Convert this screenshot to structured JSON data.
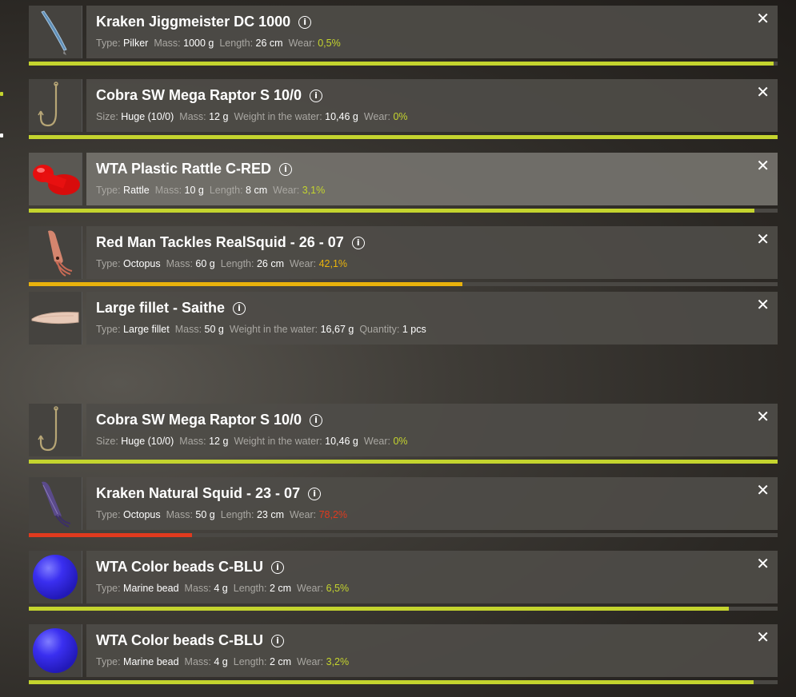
{
  "items": [
    {
      "title": "Kraken Jiggmeister DC 1000",
      "stats": [
        [
          "Type:",
          "Pilker"
        ],
        [
          "Mass:",
          "1000 g"
        ],
        [
          "Length:",
          "26 cm"
        ]
      ],
      "wear_label": "Wear:",
      "wear_value": "0,5%",
      "wear_color": "#c4d42e",
      "bar_level": 0.995,
      "bar_color": "#c4d42e",
      "has_bar": true,
      "icon": "pilker-lure-icon"
    },
    {
      "title": "Cobra SW Mega Raptor S 10/0",
      "stats": [
        [
          "Size:",
          "Huge (10/0)"
        ],
        [
          "Mass:",
          "12 g"
        ],
        [
          "Weight in the water:",
          "10,46 g"
        ]
      ],
      "wear_label": "Wear:",
      "wear_value": "0%",
      "wear_color": "#c4d42e",
      "bar_level": 1.0,
      "bar_color": "#c4d42e",
      "has_bar": true,
      "icon": "hook-icon"
    },
    {
      "title": "WTA Plastic Rattle C-RED",
      "stats": [
        [
          "Type:",
          "Rattle"
        ],
        [
          "Mass:",
          "10 g"
        ],
        [
          "Length:",
          "8 cm"
        ]
      ],
      "wear_label": "Wear:",
      "wear_value": "3,1%",
      "wear_color": "#c4d42e",
      "bar_level": 0.969,
      "bar_color": "#c4d42e",
      "has_bar": true,
      "icon": "rattle-icon",
      "highlight": true
    },
    {
      "title": "Red Man Tackles RealSquid - 26 - 07",
      "stats": [
        [
          "Type:",
          "Octopus"
        ],
        [
          "Mass:",
          "60 g"
        ],
        [
          "Length:",
          "26 cm"
        ]
      ],
      "wear_label": "Wear:",
      "wear_value": "42,1%",
      "wear_color": "#eab40c",
      "bar_level": 0.579,
      "bar_color": "#e9b20c",
      "has_bar": true,
      "icon": "squid-lure-icon"
    },
    {
      "title": "Large fillet - Saithe",
      "stats": [
        [
          "Type:",
          "Large fillet"
        ],
        [
          "Mass:",
          "50 g"
        ],
        [
          "Weight in the water:",
          "16,67 g"
        ],
        [
          "Quantity:",
          "1 pcs"
        ]
      ],
      "has_bar": false,
      "icon": "fillet-bait-icon"
    },
    {
      "title": "Cobra SW Mega Raptor S 10/0",
      "stats": [
        [
          "Size:",
          "Huge (10/0)"
        ],
        [
          "Mass:",
          "12 g"
        ],
        [
          "Weight in the water:",
          "10,46 g"
        ]
      ],
      "wear_label": "Wear:",
      "wear_value": "0%",
      "wear_color": "#c4d42e",
      "bar_level": 1.0,
      "bar_color": "#c4d42e",
      "has_bar": true,
      "icon": "hook-icon"
    },
    {
      "title": "Kraken Natural Squid - 23 - 07",
      "stats": [
        [
          "Type:",
          "Octopus"
        ],
        [
          "Mass:",
          "50 g"
        ],
        [
          "Length:",
          "23 cm"
        ]
      ],
      "wear_label": "Wear:",
      "wear_value": "78,2%",
      "wear_color": "#e03a1e",
      "bar_level": 0.218,
      "bar_color": "#e03a1e",
      "has_bar": true,
      "icon": "natural-squid-icon"
    },
    {
      "title": "WTA Color beads C-BLU",
      "stats": [
        [
          "Type:",
          "Marine bead"
        ],
        [
          "Mass:",
          "4 g"
        ],
        [
          "Length:",
          "2 cm"
        ]
      ],
      "wear_label": "Wear:",
      "wear_value": "6,5%",
      "wear_color": "#c4d42e",
      "bar_level": 0.935,
      "bar_color": "#c4d42e",
      "has_bar": true,
      "icon": "blue-bead-icon"
    },
    {
      "title": "WTA Color beads C-BLU",
      "stats": [
        [
          "Type:",
          "Marine bead"
        ],
        [
          "Mass:",
          "4 g"
        ],
        [
          "Length:",
          "2 cm"
        ]
      ],
      "wear_label": "Wear:",
      "wear_value": "3,2%",
      "wear_color": "#c4d42e",
      "bar_level": 0.968,
      "bar_color": "#c4d42e",
      "has_bar": true,
      "icon": "blue-bead-icon"
    }
  ],
  "info_glyph": "i",
  "close_glyph": "✕",
  "accent_color": "#c4d42e"
}
